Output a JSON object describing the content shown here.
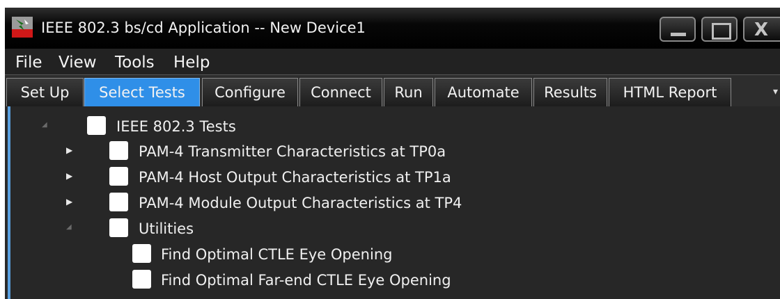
{
  "window": {
    "title": "IEEE 802.3 bs/cd Application -- New Device1",
    "controls": {
      "minimize": "_",
      "maximize": "□",
      "close": "X"
    }
  },
  "menu": [
    "File",
    "View",
    "Tools",
    "Help"
  ],
  "tabs": [
    {
      "label": "Set Up",
      "active": false
    },
    {
      "label": "Select Tests",
      "active": true
    },
    {
      "label": "Configure",
      "active": false
    },
    {
      "label": "Connect",
      "active": false
    },
    {
      "label": "Run",
      "active": false
    },
    {
      "label": "Automate",
      "active": false
    },
    {
      "label": "Results",
      "active": false
    },
    {
      "label": "HTML Report",
      "active": false
    }
  ],
  "tree": {
    "root": {
      "label": "IEEE 802.3 Tests",
      "checked": false,
      "expanded": true
    },
    "groups": [
      {
        "label": "PAM-4 Transmitter Characteristics at TP0a",
        "checked": false,
        "expanded": false
      },
      {
        "label": "PAM-4 Host Output Characteristics at TP1a",
        "checked": false,
        "expanded": false
      },
      {
        "label": "PAM-4 Module Output Characteristics at TP4",
        "checked": false,
        "expanded": false
      },
      {
        "label": "Utilities",
        "checked": false,
        "expanded": true,
        "children": [
          {
            "label": "Find Optimal CTLE Eye Opening",
            "checked": false
          },
          {
            "label": "Find Optimal Far-end CTLE Eye Opening",
            "checked": false
          }
        ]
      }
    ]
  },
  "colors": {
    "active_tab": "#2f8fe8",
    "panel_border": "#5aa0e0",
    "background": "#2a2a2a"
  }
}
